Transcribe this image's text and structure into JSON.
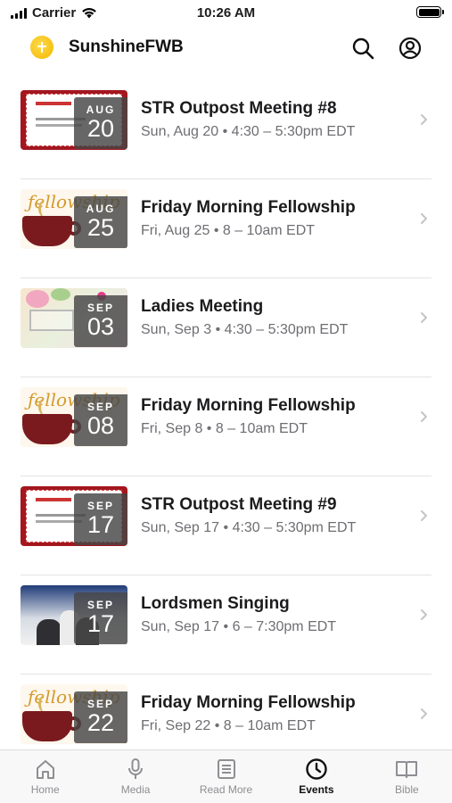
{
  "status_bar": {
    "carrier": "Carrier",
    "time": "10:26 AM"
  },
  "header": {
    "title": "SunshineFWB",
    "logo_icon": "sun-logo-icon"
  },
  "events": [
    {
      "month": "AUG",
      "day": "20",
      "title": "STR Outpost Meeting #8",
      "when": "Sun, Aug 20 • 4:30 – 5:30pm EDT",
      "art": "str"
    },
    {
      "month": "AUG",
      "day": "25",
      "title": "Friday Morning Fellowship",
      "when": "Fri, Aug 25 • 8 – 10am EDT",
      "art": "fellow"
    },
    {
      "month": "SEP",
      "day": "03",
      "title": "Ladies Meeting",
      "when": "Sun, Sep 3 • 4:30 – 5:30pm EDT",
      "art": "ladies"
    },
    {
      "month": "SEP",
      "day": "08",
      "title": "Friday Morning Fellowship",
      "when": "Fri, Sep 8 • 8 – 10am EDT",
      "art": "fellow"
    },
    {
      "month": "SEP",
      "day": "17",
      "title": "STR Outpost Meeting #9",
      "when": "Sun, Sep 17 • 4:30 – 5:30pm EDT",
      "art": "str"
    },
    {
      "month": "SEP",
      "day": "17",
      "title": "Lordsmen Singing",
      "when": "Sun, Sep 17 • 6 – 7:30pm EDT",
      "art": "photo"
    },
    {
      "month": "SEP",
      "day": "22",
      "title": "Friday Morning Fellowship",
      "when": "Fri, Sep 22 • 8 – 10am EDT",
      "art": "fellow"
    }
  ],
  "tabs": [
    {
      "label": "Home",
      "icon": "home-icon",
      "active": false
    },
    {
      "label": "Media",
      "icon": "microphone-icon",
      "active": false
    },
    {
      "label": "Read More",
      "icon": "document-icon",
      "active": false
    },
    {
      "label": "Events",
      "icon": "clock-icon",
      "active": true
    },
    {
      "label": "Bible",
      "icon": "book-icon",
      "active": false
    }
  ],
  "colors": {
    "active_tab": "#111111",
    "inactive_tab": "#8e8e93",
    "logo": "#f2b800"
  }
}
